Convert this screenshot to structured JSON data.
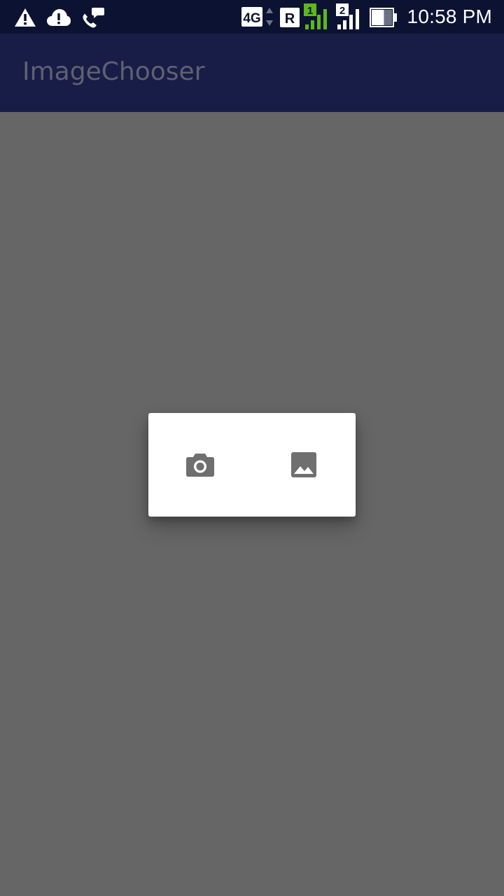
{
  "status_bar": {
    "time": "10:58 PM",
    "icons": [
      "warning-icon",
      "cloud-alert-icon",
      "call-chat-icon",
      "lte-4g-icon",
      "roaming-icon",
      "signal-sim1-icon",
      "signal-sim2-icon",
      "battery-icon"
    ],
    "network_label": "4G",
    "roaming_label": "R",
    "sim1_label": "1",
    "sim2_label": "2",
    "sim1_color": "#5cb81c",
    "battery_level": 0.6
  },
  "app_bar": {
    "title": "ImageChooser",
    "background": "#171d46"
  },
  "dialog": {
    "options": [
      {
        "icon": "camera-icon",
        "action": "camera"
      },
      {
        "icon": "image-icon",
        "action": "gallery"
      }
    ]
  },
  "colors": {
    "status_bar": "#0c1231",
    "scrim": "#666666",
    "dialog_bg": "#ffffff",
    "dialog_icon": "#6f6f6f"
  }
}
